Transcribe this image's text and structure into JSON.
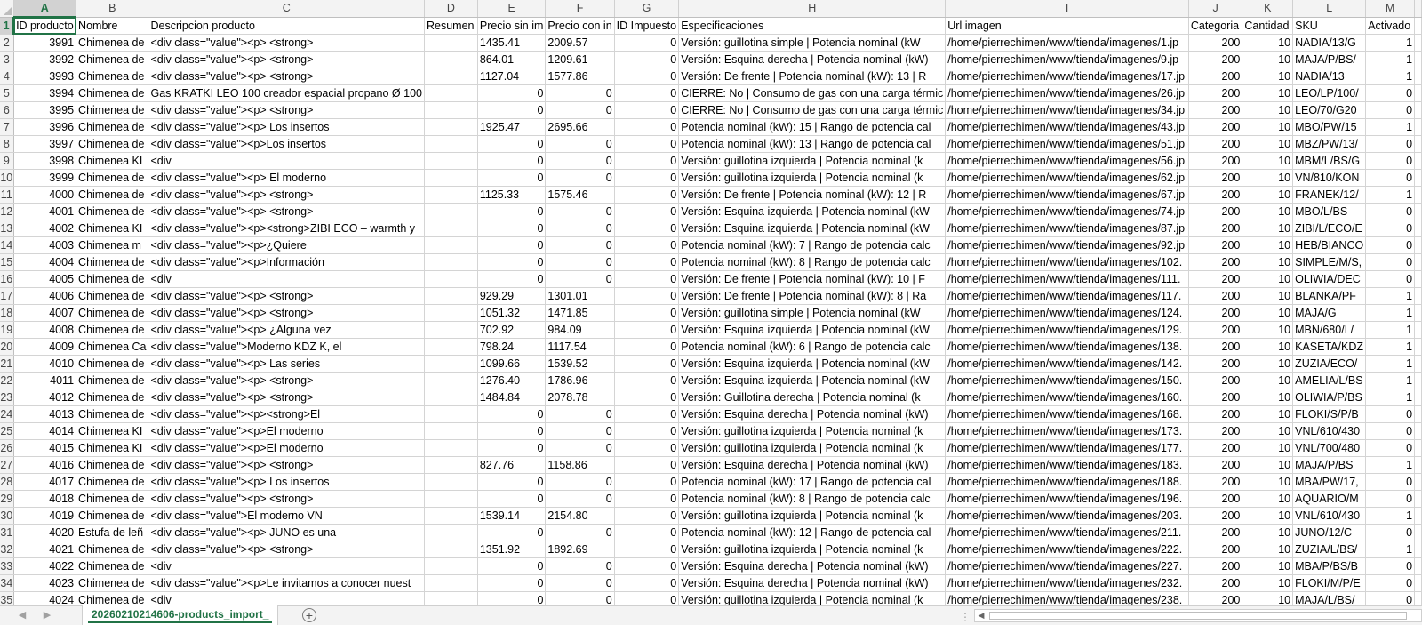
{
  "columns": [
    {
      "letter": "A",
      "label": "ID producto"
    },
    {
      "letter": "B",
      "label": "Nombre"
    },
    {
      "letter": "C",
      "label": "Descripcion producto"
    },
    {
      "letter": "D",
      "label": "Resumen"
    },
    {
      "letter": "E",
      "label": "Precio sin im"
    },
    {
      "letter": "F",
      "label": "Precio con in"
    },
    {
      "letter": "G",
      "label": "ID Impuesto"
    },
    {
      "letter": "H",
      "label": "Especificaciones"
    },
    {
      "letter": "I",
      "label": "Url imagen"
    },
    {
      "letter": "J",
      "label": "Categoria"
    },
    {
      "letter": "K",
      "label": "Cantidad"
    },
    {
      "letter": "L",
      "label": "SKU"
    },
    {
      "letter": "M",
      "label": "Activado"
    }
  ],
  "rows": [
    {
      "n": "2",
      "c": [
        "3991",
        "Chimenea de",
        "<div class=\"value\"><p> <strong>",
        "",
        "1435.41",
        "2009.57",
        "0",
        "Versión: guillotina simple | Potencia nominal (kW",
        "/home/pierrechimen/www/tienda/imagenes/1.jp",
        "200",
        "10",
        "NADIA/13/G",
        "1"
      ]
    },
    {
      "n": "3",
      "c": [
        "3992",
        "Chimenea de",
        "<div class=\"value\"><p> <strong>",
        "",
        "864.01",
        "1209.61",
        "0",
        "Versión: Esquina derecha | Potencia nominal (kW)",
        "/home/pierrechimen/www/tienda/imagenes/9.jp",
        "200",
        "10",
        "MAJA/P/BS/",
        "1"
      ]
    },
    {
      "n": "4",
      "c": [
        "3993",
        "Chimenea de",
        "<div class=\"value\"><p> <strong>",
        "",
        "1127.04",
        "1577.86",
        "0",
        "Versión: De frente | Potencia nominal (kW): 13 | R",
        "/home/pierrechimen/www/tienda/imagenes/17.jp",
        "200",
        "10",
        "NADIA/13",
        "1"
      ]
    },
    {
      "n": "5",
      "c": [
        "3994",
        "Chimenea de",
        "Gas KRATKI LEO 100 creador espacial propano Ø 100",
        "",
        "0",
        "0",
        "0",
        "CIERRE: No | Consumo de gas con una carga térmic",
        "/home/pierrechimen/www/tienda/imagenes/26.jp",
        "200",
        "10",
        "LEO/LP/100/",
        "0"
      ]
    },
    {
      "n": "6",
      "c": [
        "3995",
        "Chimenea de",
        "<div class=\"value\"><p> <strong>",
        "",
        "0",
        "0",
        "0",
        "CIERRE: No | Consumo de gas con una carga térmic",
        "/home/pierrechimen/www/tienda/imagenes/34.jp",
        "200",
        "10",
        "LEO/70/G20",
        "0"
      ]
    },
    {
      "n": "7",
      "c": [
        "3996",
        "Chimenea de",
        "<div class=\"value\"><p> Los insertos",
        "",
        "1925.47",
        "2695.66",
        "0",
        "Potencia nominal (kW): 15 | Rango de potencia cal",
        "/home/pierrechimen/www/tienda/imagenes/43.jp",
        "200",
        "10",
        "MBO/PW/15",
        "1"
      ]
    },
    {
      "n": "8",
      "c": [
        "3997",
        "Chimenea de",
        "<div class=\"value\"><p>Los insertos",
        "",
        "0",
        "0",
        "0",
        "Potencia nominal (kW): 13 | Rango de potencia cal",
        "/home/pierrechimen/www/tienda/imagenes/51.jp",
        "200",
        "10",
        "MBZ/PW/13/",
        "0"
      ]
    },
    {
      "n": "9",
      "c": [
        "3998",
        "Chimenea KI",
        "<div",
        "",
        "0",
        "0",
        "0",
        "Versión: guillotina izquierda | Potencia nominal (k",
        "/home/pierrechimen/www/tienda/imagenes/56.jp",
        "200",
        "10",
        "MBM/L/BS/G",
        "0"
      ]
    },
    {
      "n": "10",
      "c": [
        "3999",
        "Chimenea de",
        "<div class=\"value\"><p> El moderno",
        "",
        "0",
        "0",
        "0",
        "Versión: guillotina izquierda | Potencia nominal (k",
        "/home/pierrechimen/www/tienda/imagenes/62.jp",
        "200",
        "10",
        "VN/810/KON",
        "0"
      ]
    },
    {
      "n": "11",
      "c": [
        "4000",
        "Chimenea de",
        "<div class=\"value\"><p> <strong>",
        "",
        "1125.33",
        "1575.46",
        "0",
        "Versión: De frente | Potencia nominal (kW): 12 | R",
        "/home/pierrechimen/www/tienda/imagenes/67.jp",
        "200",
        "10",
        "FRANEK/12/",
        "1"
      ]
    },
    {
      "n": "12",
      "c": [
        "4001",
        "Chimenea de",
        "<div class=\"value\"><p> <strong>",
        "",
        "0",
        "0",
        "0",
        "Versión: Esquina izquierda | Potencia nominal (kW",
        "/home/pierrechimen/www/tienda/imagenes/74.jp",
        "200",
        "10",
        "MBO/L/BS",
        "0"
      ]
    },
    {
      "n": "13",
      "c": [
        "4002",
        "Chimenea KI",
        "<div class=\"value\"><p><strong>ZIBI ECO – warmth y",
        "",
        "0",
        "0",
        "0",
        "Versión: Esquina izquierda | Potencia nominal (kW",
        "/home/pierrechimen/www/tienda/imagenes/87.jp",
        "200",
        "10",
        "ZIBI/L/ECO/E",
        "0"
      ]
    },
    {
      "n": "14",
      "c": [
        "4003",
        "Chimenea m",
        "<div class=\"value\"><p>¿Quiere",
        "",
        "0",
        "0",
        "0",
        "Potencia nominal (kW): 7 | Rango de potencia calc",
        "/home/pierrechimen/www/tienda/imagenes/92.jp",
        "200",
        "10",
        "HEB/BIANCO",
        "0"
      ]
    },
    {
      "n": "15",
      "c": [
        "4004",
        "Chimenea de",
        "<div class=\"value\"><p>Información",
        "",
        "0",
        "0",
        "0",
        "Potencia nominal (kW): 8 | Rango de potencia calc",
        "/home/pierrechimen/www/tienda/imagenes/102.",
        "200",
        "10",
        "SIMPLE/M/S,",
        "0"
      ]
    },
    {
      "n": "16",
      "c": [
        "4005",
        "Chimenea de",
        "<div",
        "",
        "0",
        "0",
        "0",
        "Versión: De frente | Potencia nominal (kW): 10 | F",
        "/home/pierrechimen/www/tienda/imagenes/111.",
        "200",
        "10",
        "OLIWIA/DEC",
        "0"
      ]
    },
    {
      "n": "17",
      "c": [
        "4006",
        "Chimenea de",
        "<div class=\"value\"><p> <strong>",
        "",
        "929.29",
        "1301.01",
        "0",
        "Versión: De frente | Potencia nominal (kW): 8 | Ra",
        "/home/pierrechimen/www/tienda/imagenes/117.",
        "200",
        "10",
        "BLANKA/PF",
        "1"
      ]
    },
    {
      "n": "18",
      "c": [
        "4007",
        "Chimenea de",
        "<div class=\"value\"><p> <strong>",
        "",
        "1051.32",
        "1471.85",
        "0",
        "Versión: guillotina simple | Potencia nominal (kW",
        "/home/pierrechimen/www/tienda/imagenes/124.",
        "200",
        "10",
        "MAJA/G",
        "1"
      ]
    },
    {
      "n": "19",
      "c": [
        "4008",
        "Chimenea de",
        "<div class=\"value\"><p> ¿Alguna vez",
        "",
        "702.92",
        "984.09",
        "0",
        "Versión: Esquina izquierda | Potencia nominal (kW",
        "/home/pierrechimen/www/tienda/imagenes/129.",
        "200",
        "10",
        "MBN/680/L/",
        "1"
      ]
    },
    {
      "n": "20",
      "c": [
        "4009",
        "Chimenea Ca",
        "<div class=\"value\">Moderno KDZ K, el",
        "",
        "798.24",
        "1117.54",
        "0",
        "Potencia nominal (kW): 6 | Rango de potencia calc",
        "/home/pierrechimen/www/tienda/imagenes/138.",
        "200",
        "10",
        "KASETA/KDZ",
        "1"
      ]
    },
    {
      "n": "21",
      "c": [
        "4010",
        "Chimenea de",
        "<div class=\"value\"><p> Las series",
        "",
        "1099.66",
        "1539.52",
        "0",
        "Versión: Esquina izquierda | Potencia nominal (kW",
        "/home/pierrechimen/www/tienda/imagenes/142.",
        "200",
        "10",
        "ZUZIA/ECO/",
        "1"
      ]
    },
    {
      "n": "22",
      "c": [
        "4011",
        "Chimenea de",
        "<div class=\"value\"><p> <strong>",
        "",
        "1276.40",
        "1786.96",
        "0",
        "Versión: Esquina izquierda | Potencia nominal (kW",
        "/home/pierrechimen/www/tienda/imagenes/150.",
        "200",
        "10",
        "AMELIA/L/BS",
        "1"
      ]
    },
    {
      "n": "23",
      "c": [
        "4012",
        "Chimenea de",
        "<div class=\"value\"><p> <strong>",
        "",
        "1484.84",
        "2078.78",
        "0",
        "Versión: Guillotina derecha | Potencia nominal (k",
        "/home/pierrechimen/www/tienda/imagenes/160.",
        "200",
        "10",
        "OLIWIA/P/BS",
        "1"
      ]
    },
    {
      "n": "24",
      "c": [
        "4013",
        "Chimenea de",
        "<div class=\"value\"><p><strong>El",
        "",
        "0",
        "0",
        "0",
        "Versión: Esquina derecha | Potencia nominal (kW)",
        "/home/pierrechimen/www/tienda/imagenes/168.",
        "200",
        "10",
        "FLOKI/S/P/B",
        "0"
      ]
    },
    {
      "n": "25",
      "c": [
        "4014",
        "Chimenea KI",
        "<div class=\"value\"><p>El moderno",
        "",
        "0",
        "0",
        "0",
        "Versión: guillotina izquierda | Potencia nominal (k",
        "/home/pierrechimen/www/tienda/imagenes/173.",
        "200",
        "10",
        "VNL/610/430",
        "0"
      ]
    },
    {
      "n": "26",
      "c": [
        "4015",
        "Chimenea KI",
        "<div class=\"value\"><p>El moderno",
        "",
        "0",
        "0",
        "0",
        "Versión: guillotina izquierda | Potencia nominal (k",
        "/home/pierrechimen/www/tienda/imagenes/177.",
        "200",
        "10",
        "VNL/700/480",
        "0"
      ]
    },
    {
      "n": "27",
      "c": [
        "4016",
        "Chimenea de",
        "<div class=\"value\"><p> <strong>",
        "",
        "827.76",
        "1158.86",
        "0",
        "Versión: Esquina derecha | Potencia nominal (kW)",
        "/home/pierrechimen/www/tienda/imagenes/183.",
        "200",
        "10",
        "MAJA/P/BS",
        "1"
      ]
    },
    {
      "n": "28",
      "c": [
        "4017",
        "Chimenea de",
        "<div class=\"value\"><p> Los insertos",
        "",
        "0",
        "0",
        "0",
        "Potencia nominal (kW): 17 | Rango de potencia cal",
        "/home/pierrechimen/www/tienda/imagenes/188.",
        "200",
        "10",
        "MBA/PW/17,",
        "0"
      ]
    },
    {
      "n": "29",
      "c": [
        "4018",
        "Chimenea de",
        "<div class=\"value\"><p> <strong>",
        "",
        "0",
        "0",
        "0",
        "Potencia nominal (kW): 8 | Rango de potencia calc",
        "/home/pierrechimen/www/tienda/imagenes/196.",
        "200",
        "10",
        "AQUARIO/M",
        "0"
      ]
    },
    {
      "n": "30",
      "c": [
        "4019",
        "Chimenea de",
        "<div class=\"value\">El moderno VN",
        "",
        "1539.14",
        "2154.80",
        "0",
        "Versión: guillotina izquierda | Potencia nominal (k",
        "/home/pierrechimen/www/tienda/imagenes/203.",
        "200",
        "10",
        "VNL/610/430",
        "1"
      ]
    },
    {
      "n": "31",
      "c": [
        "4020",
        "Estufa de leñ",
        "<div class=\"value\"><p> JUNO es una",
        "",
        "0",
        "0",
        "0",
        "Potencia nominal (kW): 12 | Rango de potencia cal",
        "/home/pierrechimen/www/tienda/imagenes/211.",
        "200",
        "10",
        "JUNO/12/C",
        "0"
      ]
    },
    {
      "n": "32",
      "c": [
        "4021",
        "Chimenea de",
        "<div class=\"value\"><p> <strong>",
        "",
        "1351.92",
        "1892.69",
        "0",
        "Versión: guillotina izquierda | Potencia nominal (k",
        "/home/pierrechimen/www/tienda/imagenes/222.",
        "200",
        "10",
        "ZUZIA/L/BS/",
        "1"
      ]
    },
    {
      "n": "33",
      "c": [
        "4022",
        "Chimenea de",
        "<div",
        "",
        "0",
        "0",
        "0",
        "Versión: Esquina derecha | Potencia nominal (kW)",
        "/home/pierrechimen/www/tienda/imagenes/227.",
        "200",
        "10",
        "MBA/P/BS/B",
        "0"
      ]
    },
    {
      "n": "34",
      "c": [
        "4023",
        "Chimenea de",
        "<div class=\"value\"><p>Le invitamos a conocer nuest",
        "",
        "0",
        "0",
        "0",
        "Versión: Esquina derecha | Potencia nominal (kW)",
        "/home/pierrechimen/www/tienda/imagenes/232.",
        "200",
        "10",
        "FLOKI/M/P/E",
        "0"
      ]
    },
    {
      "n": "35",
      "c": [
        "4024",
        "Chimenea de",
        "<div",
        "",
        "0",
        "0",
        "0",
        "Versión: guillotina izquierda | Potencia nominal (k",
        "/home/pierrechimen/www/tienda/imagenes/238.",
        "200",
        "10",
        "MAJA/L/BS/",
        "0"
      ]
    }
  ],
  "sheet_tab": {
    "label": "20260210214606-products_import_"
  },
  "icons": {
    "add_sheet": "plus-circle-icon",
    "nav_prev": "triangle-left-icon",
    "nav_next": "triangle-right-icon"
  },
  "colors": {
    "accent": "#217346",
    "header_bg": "#f3f3f3",
    "gridline": "#d4d4d4"
  }
}
